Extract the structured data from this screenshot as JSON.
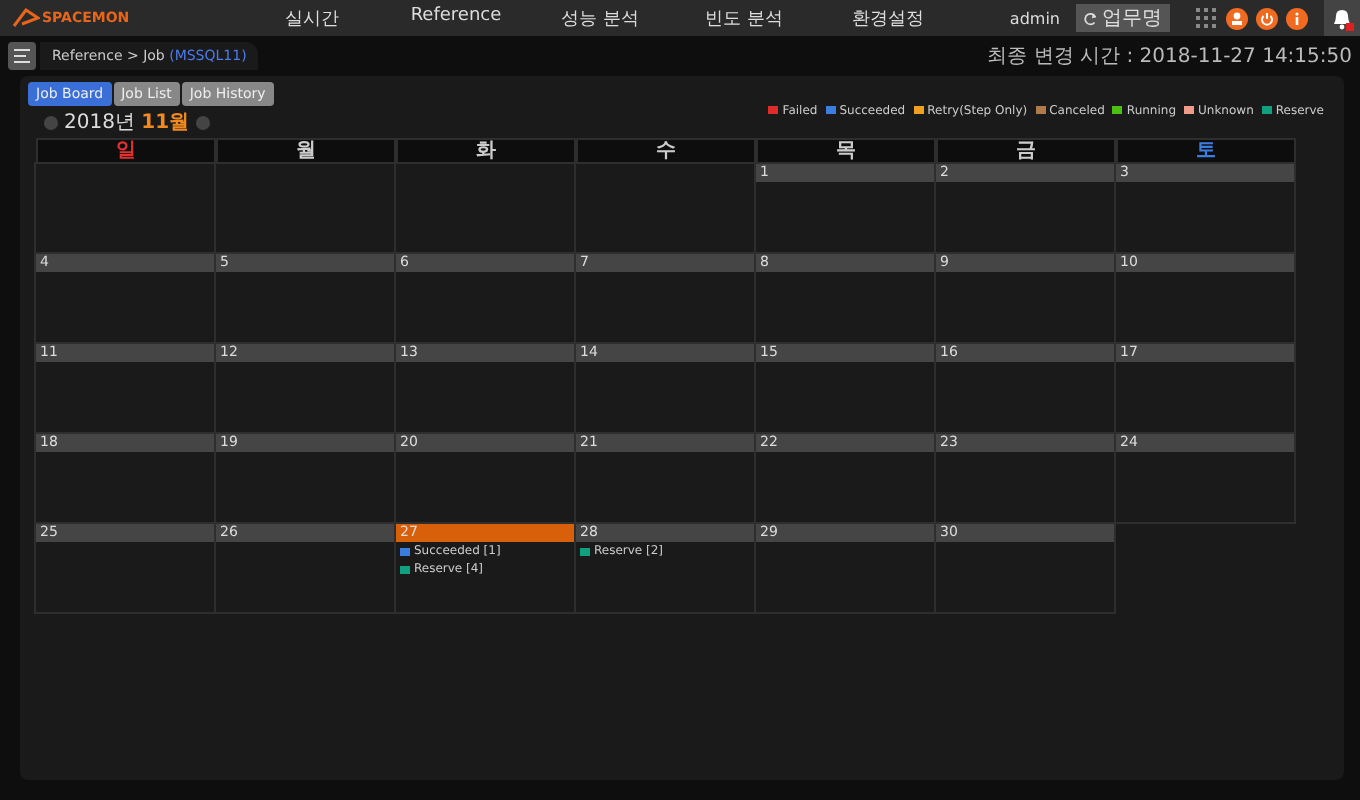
{
  "nav": {
    "menu": [
      {
        "label": "실시간"
      },
      {
        "label": "Reference"
      },
      {
        "label": "성능 분석"
      },
      {
        "label": "빈도 분석"
      },
      {
        "label": "환경설정"
      }
    ],
    "user": "admin",
    "work_button": "업무명"
  },
  "logo": "SPACEMON",
  "breadcrumb": {
    "path": "Reference > Job",
    "target": "(MSSQL11)"
  },
  "last_update": "최종 변경 시간 : 2018-11-27 14:15:50",
  "tabs": [
    {
      "label": "Job Board",
      "selected": true
    },
    {
      "label": "Job List",
      "selected": false
    },
    {
      "label": "Job History",
      "selected": false
    }
  ],
  "month": {
    "year": "2018년",
    "month": "11월"
  },
  "legend": [
    {
      "label": "Failed",
      "color": "#e02b2b"
    },
    {
      "label": "Succeeded",
      "color": "#3b7de0"
    },
    {
      "label": "Retry(Step Only)",
      "color": "#f0a020"
    },
    {
      "label": "Canceled",
      "color": "#b07a4a"
    },
    {
      "label": "Running",
      "color": "#4cc010"
    },
    {
      "label": "Unknown",
      "color": "#f09a8a"
    },
    {
      "label": "Reserve",
      "color": "#10a080"
    }
  ],
  "weekdays": [
    {
      "label": "일",
      "color": "#e03030"
    },
    {
      "label": "월"
    },
    {
      "label": "화"
    },
    {
      "label": "수"
    },
    {
      "label": "목"
    },
    {
      "label": "금"
    },
    {
      "label": "토",
      "color": "#3b7de0"
    }
  ],
  "weeks": [
    {
      "days": [
        {
          "kind": "blank"
        },
        {
          "kind": "blank"
        },
        {
          "kind": "blank"
        },
        {
          "kind": "blank"
        },
        {
          "kind": "day",
          "day": "1",
          "selected": false
        },
        {
          "kind": "day",
          "day": "2",
          "selected": false
        },
        {
          "kind": "day",
          "day": "3",
          "selected": false
        }
      ]
    },
    {
      "days": [
        {
          "kind": "day",
          "day": "4",
          "selected": false
        },
        {
          "kind": "day",
          "day": "5",
          "selected": false
        },
        {
          "kind": "day",
          "day": "6",
          "selected": false
        },
        {
          "kind": "day",
          "day": "7",
          "selected": false
        },
        {
          "kind": "day",
          "day": "8",
          "selected": false
        },
        {
          "kind": "day",
          "day": "9",
          "selected": false
        },
        {
          "kind": "day",
          "day": "10",
          "selected": false
        }
      ]
    },
    {
      "days": [
        {
          "kind": "day",
          "day": "11",
          "selected": false
        },
        {
          "kind": "day",
          "day": "12",
          "selected": false
        },
        {
          "kind": "day",
          "day": "13",
          "selected": false
        },
        {
          "kind": "day",
          "day": "14",
          "selected": false
        },
        {
          "kind": "day",
          "day": "15",
          "selected": false
        },
        {
          "kind": "day",
          "day": "16",
          "selected": false
        },
        {
          "kind": "day",
          "day": "17",
          "selected": false
        }
      ]
    },
    {
      "days": [
        {
          "kind": "day",
          "day": "18",
          "selected": false
        },
        {
          "kind": "day",
          "day": "19",
          "selected": false
        },
        {
          "kind": "day",
          "day": "20",
          "selected": false
        },
        {
          "kind": "day",
          "day": "21",
          "selected": false
        },
        {
          "kind": "day",
          "day": "22",
          "selected": false
        },
        {
          "kind": "day",
          "day": "23",
          "selected": false
        },
        {
          "kind": "day",
          "day": "24",
          "selected": false
        }
      ]
    },
    {
      "days": [
        {
          "kind": "day",
          "day": "25",
          "selected": false
        },
        {
          "kind": "day",
          "day": "26",
          "selected": false
        },
        {
          "kind": "day",
          "day": "27",
          "selected": true,
          "events": [
            {
              "label": "Succeeded [1]",
              "color": "#3b7de0"
            },
            {
              "label": "Reserve [4]",
              "color": "#10a080"
            }
          ]
        },
        {
          "kind": "day",
          "day": "28",
          "selected": false,
          "events": [
            {
              "label": "Reserve [2]",
              "color": "#10a080"
            }
          ]
        },
        {
          "kind": "day",
          "day": "29",
          "selected": false
        },
        {
          "kind": "day",
          "day": "30",
          "selected": false
        }
      ]
    }
  ]
}
